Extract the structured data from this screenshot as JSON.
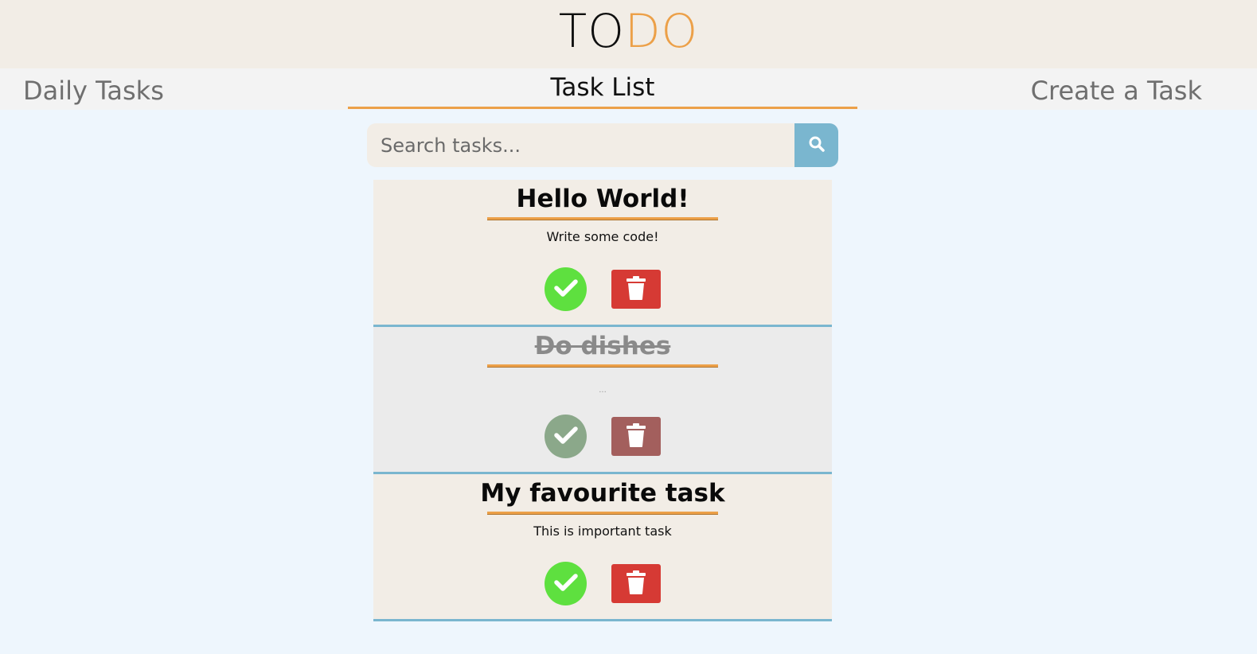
{
  "header": {
    "logo_part1": "TO",
    "logo_part2": "DO"
  },
  "nav": {
    "daily": "Daily Tasks",
    "list": "Task List",
    "create": "Create a Task"
  },
  "search": {
    "placeholder": "Search tasks..."
  },
  "tasks": [
    {
      "title": "Hello World!",
      "description": "Write some code!",
      "completed": false
    },
    {
      "title": "Do dishes",
      "description": "...",
      "completed": true
    },
    {
      "title": "My favourite task",
      "description": "This is important task",
      "completed": false
    }
  ],
  "colors": {
    "accent": "#eca048",
    "header_bg": "#f2ede6",
    "page_bg": "#eef6fd",
    "search_button": "#7ab6cf",
    "done_button": "#5ee03f",
    "delete_button": "#d63a34"
  },
  "icons": {
    "search": "search-icon",
    "done": "check-icon",
    "delete": "trash-icon"
  }
}
